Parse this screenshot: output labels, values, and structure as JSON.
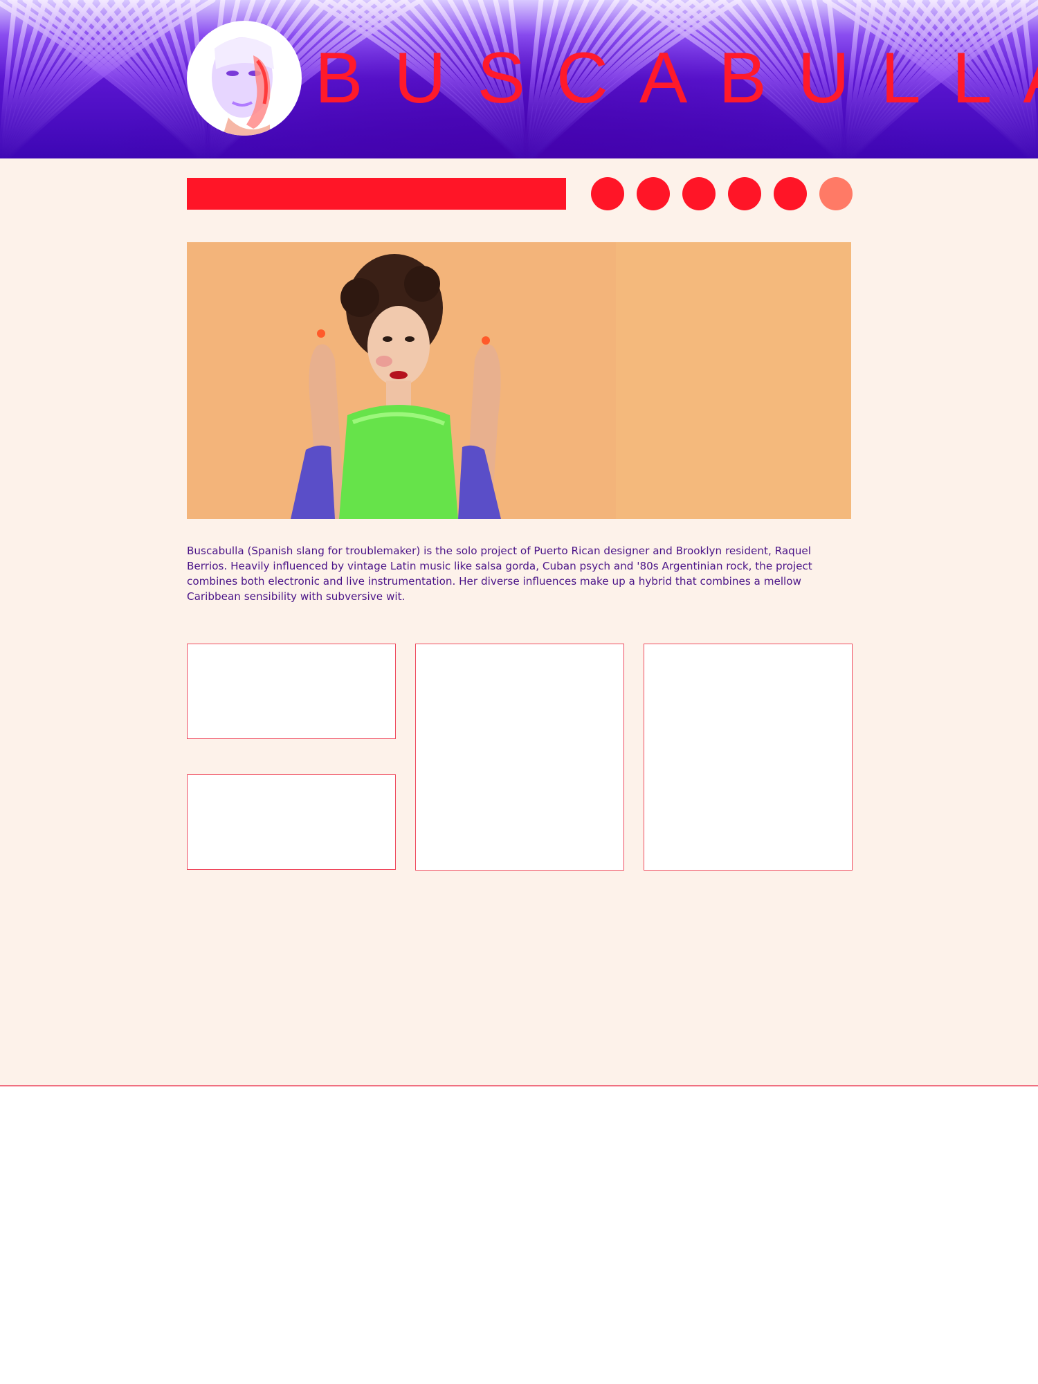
{
  "header": {
    "brand": "BUSCABULLA",
    "avatar_icon": "portrait-avatar-icon",
    "colors": {
      "banner": "#4a0ac0",
      "brand_text": "#ff1a2b"
    }
  },
  "nav": {
    "menu_bar_color": "#ff1527",
    "social_icons": [
      {
        "name": "social-icon-1",
        "color": "#ff1527"
      },
      {
        "name": "social-icon-2",
        "color": "#ff1527"
      },
      {
        "name": "social-icon-3",
        "color": "#ff1527"
      },
      {
        "name": "social-icon-4",
        "color": "#ff1527"
      },
      {
        "name": "social-icon-5",
        "color": "#ff1527"
      },
      {
        "name": "social-icon-6",
        "color": "#ff7a66"
      }
    ]
  },
  "hero": {
    "background": "#f4b97c"
  },
  "bio": {
    "text": "Buscabulla (Spanish slang for troublemaker) is the solo project of Puerto Rican designer and Brooklyn resident, Raquel Berrios. Heavily influenced by vintage Latin music like salsa gorda, Cuban psych and '80s Argentinian rock, the project combines both electronic and live instrumentation. Her diverse influences make up a hybrid that combines a mellow Caribbean sensibility with subversive wit.",
    "color": "#4a1488"
  },
  "content_cards": {
    "count": 4,
    "border_color": "#ef4a5e"
  },
  "page": {
    "background": "#fdf2ea"
  }
}
